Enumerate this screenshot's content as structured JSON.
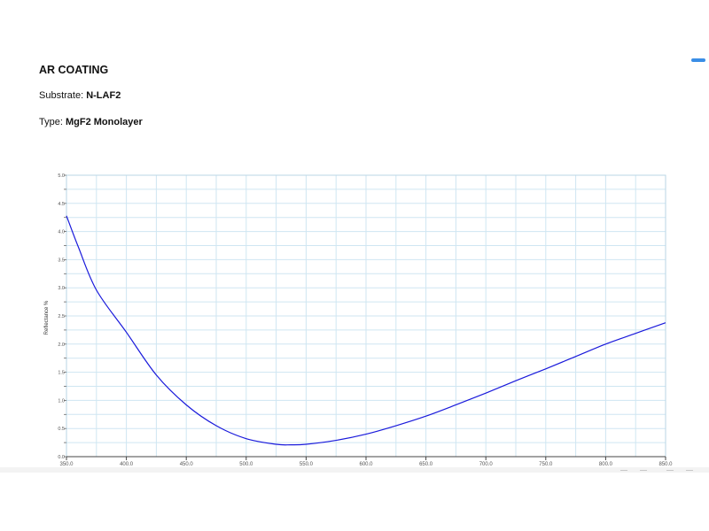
{
  "header": {
    "title": "AR COATING",
    "substrate_label": "Substrate:",
    "substrate_value": "N-LAF2",
    "type_label": "Type:",
    "type_value": "MgF2 Monolayer"
  },
  "colors": {
    "curve": "#1a1adb",
    "grid": "#cfe6f2",
    "axis_text": "#555555",
    "accent_tab": "#3a8ee6"
  },
  "chart_data": {
    "type": "line",
    "ylabel": "Reflectance %",
    "xlabel": "",
    "xlim": [
      350,
      850
    ],
    "ylim": [
      0,
      5
    ],
    "x_ticks": [
      "350.0",
      "400.0",
      "450.0",
      "500.0",
      "550.0",
      "600.0",
      "650.0",
      "700.0",
      "750.0",
      "800.0",
      "850.0"
    ],
    "y_ticks": [
      "0.0",
      "0.5",
      "1.0",
      "1.5",
      "2.0",
      "2.5",
      "3.0",
      "3.5",
      "4.0",
      "4.5",
      "5.0"
    ],
    "grid": true,
    "series": [
      {
        "x": [
          350,
          360,
          375,
          400,
          425,
          450,
          475,
          500,
          525,
          537,
          550,
          575,
          600,
          625,
          650,
          675,
          700,
          725,
          750,
          775,
          800,
          825,
          850
        ],
        "y": [
          4.28,
          3.72,
          2.96,
          2.21,
          1.45,
          0.92,
          0.55,
          0.32,
          0.22,
          0.21,
          0.22,
          0.29,
          0.4,
          0.55,
          0.72,
          0.92,
          1.13,
          1.35,
          1.56,
          1.78,
          2.0,
          2.19,
          2.38
        ]
      }
    ]
  }
}
